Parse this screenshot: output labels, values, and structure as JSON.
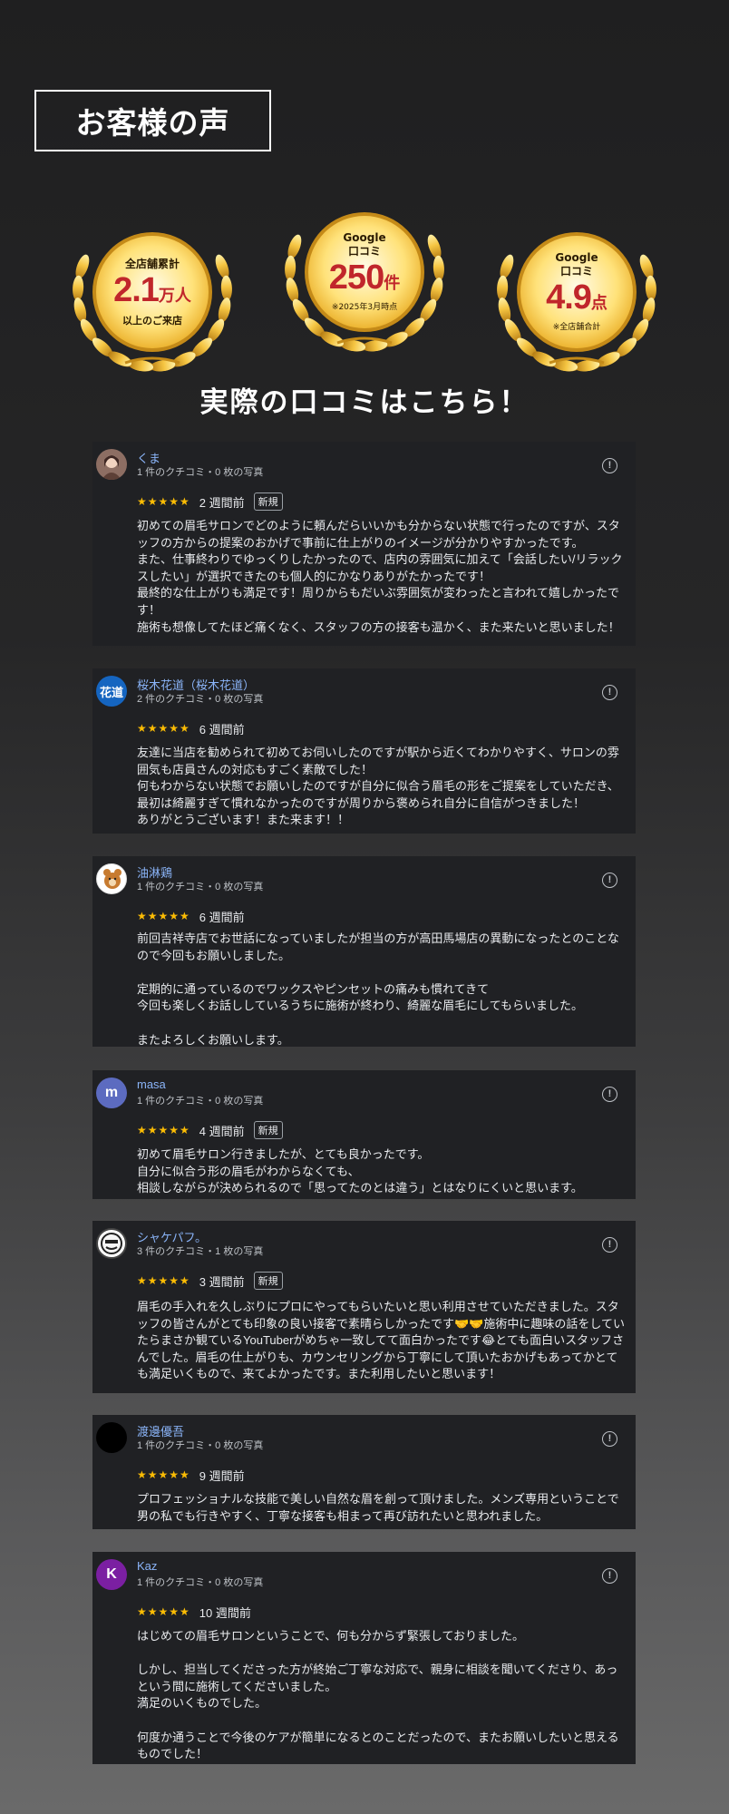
{
  "section_title": "お客様の声",
  "badges": [
    {
      "top": "全店舗累計",
      "value": "2.1",
      "unit": "万人",
      "bottom": "以上のご来店",
      "note": ""
    },
    {
      "top": "Google",
      "top2": "口コミ",
      "value": "250",
      "unit": "件",
      "bottom": "",
      "note": "※2025年3月時点"
    },
    {
      "top": "Google",
      "top2": "口コミ",
      "value": "4.9",
      "unit": "点",
      "bottom": "",
      "note": "※全店舗合計"
    }
  ],
  "subheading": "実際の口コミはこちら！",
  "colors": {
    "star": "#fbbc04",
    "name": "#8ab4f8",
    "card_bg": "#202124",
    "badge_red": "#c0262b"
  },
  "reviews": [
    {
      "name": "くま",
      "meta": "1 件のクチコミ・0 枚の写真",
      "stars": "★★★★★",
      "ago": "2 週間前",
      "tag": "新規",
      "avatar_text": "",
      "avatar_color": "#8d6e63",
      "body": "初めての眉毛サロンでどのように頼んだらいいかも分からない状態で行ったのですが、スタッフの方からの提案のおかげで事前に仕上がりのイメージが分かりやすかったです。\nまた、仕事終わりでゆっくりしたかったので、店内の雰囲気に加えて「会話したい/リラックスしたい」が選択できたのも個人的にかなりありがたかったです！\n最終的な仕上がりも満足です！周りからもだいぶ雰囲気が変わったと言われて嬉しかったです！\n施術も想像してたほど痛くなく、スタッフの方の接客も温かく、また来たいと思いました！"
    },
    {
      "name": "桜木花道（桜木花道）",
      "meta": "2 件のクチコミ・0 枚の写真",
      "stars": "★★★★★",
      "ago": "6 週間前",
      "tag": "",
      "avatar_text": "花道",
      "avatar_color": "#1565c0",
      "body": "友達に当店を勧められて初めてお伺いしたのですが駅から近くてわかりやすく、サロンの雰囲気も店員さんの対応もすごく素敵でした！\n何もわからない状態でお願いしたのですが自分に似合う眉毛の形をご提案をしていただき、最初は綺麗すぎて慣れなかったのですが周りから褒められ自分に自信がつきました！\nありがとうございます！また来ます！！"
    },
    {
      "name": "油淋鶏",
      "meta": "1 件のクチコミ・0 枚の写真",
      "stars": "★★★★★",
      "ago": "6 週間前",
      "tag": "",
      "avatar_text": "",
      "avatar_color": "#ffffff",
      "body": "前回吉祥寺店でお世話になっていましたが担当の方が高田馬場店の異動になったとのことなので今回もお願いしました。\n\n定期的に通っているのでワックスやピンセットの痛みも慣れてきて\n今回も楽しくお話ししているうちに施術が終わり、綺麗な眉毛にしてもらいました。\n\nまたよろしくお願いします。"
    },
    {
      "name": "masa",
      "meta": "1 件のクチコミ・0 枚の写真",
      "stars": "★★★★★",
      "ago": "4 週間前",
      "tag": "新規",
      "avatar_text": "m",
      "avatar_color": "#5c6bc0",
      "body": "初めて眉毛サロン行きましたが、とても良かったです。\n自分に似合う形の眉毛がわからなくても、\n相談しながらが決められるので「思ってたのとは違う」とはなりにくいと思います。"
    },
    {
      "name": "シャケパフ。",
      "meta": "3 件のクチコミ・1 枚の写真",
      "stars": "★★★★★",
      "ago": "3 週間前",
      "tag": "新規",
      "avatar_text": "",
      "avatar_color": "#ffffff",
      "body": "眉毛の手入れを久しぶりにプロにやってもらいたいと思い利用させていただきました。スタッフの皆さんがとても印象の良い接客で素晴らしかったです🤝🤝施術中に趣味の話をしていたらまさか観ているYouTuberがめちゃ一致してて面白かったです😂とても面白いスタッフさんでした。眉毛の仕上がりも、カウンセリングから丁寧にして頂いたおかげもあってかとても満足いくもので、来てよかったです。また利用したいと思います！"
    },
    {
      "name": "渡邊優吾",
      "meta": "1 件のクチコミ・0 枚の写真",
      "stars": "★★★★★",
      "ago": "9 週間前",
      "tag": "",
      "avatar_text": "",
      "avatar_color": "#000000",
      "body": "プロフェッショナルな技能で美しい自然な眉を創って頂けました。メンズ専用ということで男の私でも行きやすく、丁寧な接客も相まって再び訪れたいと思われました。"
    },
    {
      "name": "Kaz",
      "meta": "1 件のクチコミ・0 枚の写真",
      "stars": "★★★★★",
      "ago": "10 週間前",
      "tag": "",
      "avatar_text": "K",
      "avatar_color": "#7b1fa2",
      "body": "はじめての眉毛サロンということで、何も分からず緊張しておりました。\n\nしかし、担当してくださった方が終始ご丁寧な対応で、親身に相談を聞いてくださり、あっという間に施術してくださいました。\n満足のいくものでした。\n\n何度か通うことで今後のケアが簡単になるとのことだったので、またお願いしたいと思えるものでした！"
    }
  ]
}
